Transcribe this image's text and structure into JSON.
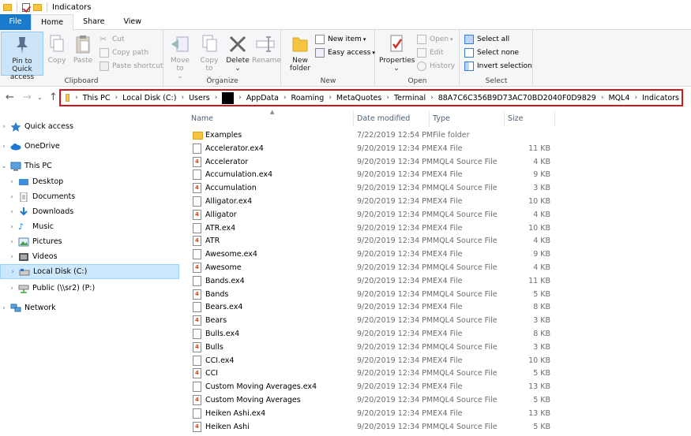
{
  "window": {
    "title": "Indicators"
  },
  "tabs": [
    "File",
    "Home",
    "Share",
    "View"
  ],
  "ribbon": {
    "clipboard": {
      "label": "Clipboard",
      "pin": "Pin to Quick access",
      "copy": "Copy",
      "paste": "Paste",
      "cut": "Cut",
      "copy_path": "Copy path",
      "paste_shortcut": "Paste shortcut"
    },
    "organize": {
      "label": "Organize",
      "move_to": "Move to",
      "copy_to": "Copy to",
      "delete": "Delete",
      "rename": "Rename"
    },
    "new": {
      "label": "New",
      "new_folder": "New folder",
      "new_item": "New item",
      "easy_access": "Easy access"
    },
    "open": {
      "label": "Open",
      "properties": "Properties",
      "open": "Open",
      "edit": "Edit",
      "history": "History"
    },
    "select": {
      "label": "Select",
      "select_all": "Select all",
      "select_none": "Select none",
      "invert": "Invert selection"
    }
  },
  "address": {
    "crumbs": [
      "This PC",
      "Local Disk (C:)",
      "Users",
      "",
      "AppData",
      "Roaming",
      "MetaQuotes",
      "Terminal",
      "88A7C6C356B9D73AC70BD2040F0D9829",
      "MQL4",
      "Indicators"
    ]
  },
  "nav": {
    "items": [
      {
        "label": "Quick access",
        "icon": "star-icon"
      },
      {
        "label": "OneDrive",
        "icon": "cloud-icon"
      },
      {
        "label": "This PC",
        "icon": "computer-icon"
      },
      {
        "label": "Desktop",
        "icon": "desktop-icon"
      },
      {
        "label": "Documents",
        "icon": "documents-icon"
      },
      {
        "label": "Downloads",
        "icon": "downloads-icon"
      },
      {
        "label": "Music",
        "icon": "music-icon"
      },
      {
        "label": "Pictures",
        "icon": "pictures-icon"
      },
      {
        "label": "Videos",
        "icon": "videos-icon"
      },
      {
        "label": "Local Disk (C:)",
        "icon": "drive-icon"
      },
      {
        "label": "Public (\\\\sr2) (P:)",
        "icon": "network-drive-icon"
      },
      {
        "label": "Network",
        "icon": "network-icon"
      }
    ]
  },
  "columns": {
    "name": "Name",
    "date": "Date modified",
    "type": "Type",
    "size": "Size"
  },
  "files": [
    {
      "name": "Examples",
      "date": "7/22/2019 12:54 PM",
      "type": "File folder",
      "size": "",
      "kind": "folder"
    },
    {
      "name": "Accelerator.ex4",
      "date": "9/20/2019 12:34 PM",
      "type": "EX4 File",
      "size": "11 KB",
      "kind": "ex4"
    },
    {
      "name": "Accelerator",
      "date": "9/20/2019 12:34 PM",
      "type": "MQL4 Source File",
      "size": "4 KB",
      "kind": "mq4"
    },
    {
      "name": "Accumulation.ex4",
      "date": "9/20/2019 12:34 PM",
      "type": "EX4 File",
      "size": "9 KB",
      "kind": "ex4"
    },
    {
      "name": "Accumulation",
      "date": "9/20/2019 12:34 PM",
      "type": "MQL4 Source File",
      "size": "3 KB",
      "kind": "mq4"
    },
    {
      "name": "Alligator.ex4",
      "date": "9/20/2019 12:34 PM",
      "type": "EX4 File",
      "size": "10 KB",
      "kind": "ex4"
    },
    {
      "name": "Alligator",
      "date": "9/20/2019 12:34 PM",
      "type": "MQL4 Source File",
      "size": "4 KB",
      "kind": "mq4"
    },
    {
      "name": "ATR.ex4",
      "date": "9/20/2019 12:34 PM",
      "type": "EX4 File",
      "size": "10 KB",
      "kind": "ex4"
    },
    {
      "name": "ATR",
      "date": "9/20/2019 12:34 PM",
      "type": "MQL4 Source File",
      "size": "4 KB",
      "kind": "mq4"
    },
    {
      "name": "Awesome.ex4",
      "date": "9/20/2019 12:34 PM",
      "type": "EX4 File",
      "size": "9 KB",
      "kind": "ex4"
    },
    {
      "name": "Awesome",
      "date": "9/20/2019 12:34 PM",
      "type": "MQL4 Source File",
      "size": "4 KB",
      "kind": "mq4"
    },
    {
      "name": "Bands.ex4",
      "date": "9/20/2019 12:34 PM",
      "type": "EX4 File",
      "size": "11 KB",
      "kind": "ex4"
    },
    {
      "name": "Bands",
      "date": "9/20/2019 12:34 PM",
      "type": "MQL4 Source File",
      "size": "5 KB",
      "kind": "mq4"
    },
    {
      "name": "Bears.ex4",
      "date": "9/20/2019 12:34 PM",
      "type": "EX4 File",
      "size": "8 KB",
      "kind": "ex4"
    },
    {
      "name": "Bears",
      "date": "9/20/2019 12:34 PM",
      "type": "MQL4 Source File",
      "size": "3 KB",
      "kind": "mq4"
    },
    {
      "name": "Bulls.ex4",
      "date": "9/20/2019 12:34 PM",
      "type": "EX4 File",
      "size": "8 KB",
      "kind": "ex4"
    },
    {
      "name": "Bulls",
      "date": "9/20/2019 12:34 PM",
      "type": "MQL4 Source File",
      "size": "3 KB",
      "kind": "mq4"
    },
    {
      "name": "CCI.ex4",
      "date": "9/20/2019 12:34 PM",
      "type": "EX4 File",
      "size": "10 KB",
      "kind": "ex4"
    },
    {
      "name": "CCI",
      "date": "9/20/2019 12:34 PM",
      "type": "MQL4 Source File",
      "size": "5 KB",
      "kind": "mq4"
    },
    {
      "name": "Custom Moving Averages.ex4",
      "date": "9/20/2019 12:34 PM",
      "type": "EX4 File",
      "size": "13 KB",
      "kind": "ex4"
    },
    {
      "name": "Custom Moving Averages",
      "date": "9/20/2019 12:34 PM",
      "type": "MQL4 Source File",
      "size": "5 KB",
      "kind": "mq4"
    },
    {
      "name": "Heiken Ashi.ex4",
      "date": "9/20/2019 12:34 PM",
      "type": "EX4 File",
      "size": "13 KB",
      "kind": "ex4"
    },
    {
      "name": "Heiken Ashi",
      "date": "9/20/2019 12:34 PM",
      "type": "MQL4 Source File",
      "size": "5 KB",
      "kind": "mq4"
    }
  ]
}
